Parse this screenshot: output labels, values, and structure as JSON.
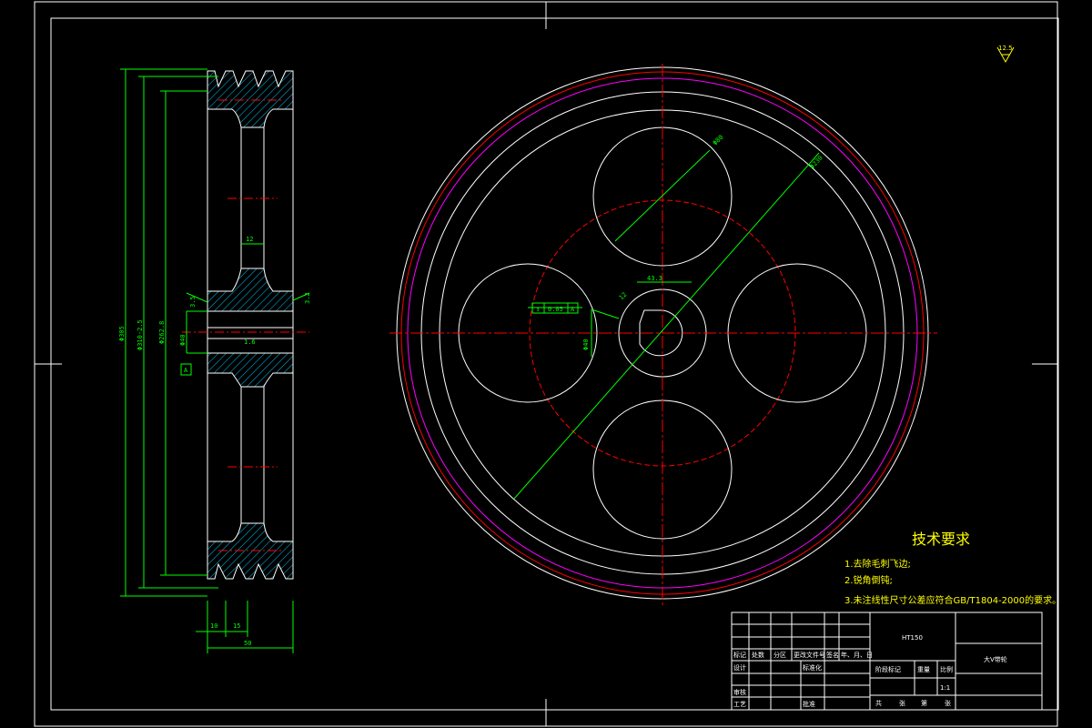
{
  "drawing": {
    "roughness": "12.5",
    "tech_requirements": {
      "title": "技术要求",
      "items": [
        "1.去除毛刺飞边;",
        "2.锐角倒钝;",
        "3.未注线性尺寸公差应符合GB/T1804-2000的要求。"
      ]
    },
    "side_view_dims": {
      "d_outer": "Φ305",
      "d_pitch": "Φ310-2.5",
      "d_hub": "Φ262.8",
      "d_bore": "Φ40",
      "web_thickness": "12",
      "groove_w1": "10",
      "groove_w2": "15",
      "total_width": "50",
      "datum": "A",
      "r1": "3.5",
      "r2": "3.2",
      "keyway": "1.6"
    },
    "front_view_dims": {
      "hole_dia": "Φ80",
      "bolt_circle": "Φ230",
      "key_width": "12",
      "hub_dia": "Φ40",
      "depth": "43.3",
      "tolerance_frame": [
        "↕",
        "0.05",
        "A"
      ]
    },
    "title_block": {
      "material": "HT150",
      "part_name": "大V带轮",
      "scale_label": "比例",
      "scale": "1:1",
      "headers": [
        "标记",
        "处数",
        "分区",
        "更改文件号",
        "签名",
        "年、月、日"
      ],
      "rows_left": [
        "设计",
        "",
        "审核",
        "工艺"
      ],
      "std_label": "标准化",
      "approve_label": "批准",
      "stage_label": "阶段标记",
      "weight_label": "重量",
      "sheet_labels": [
        "共",
        "张",
        "第",
        "张"
      ]
    }
  }
}
